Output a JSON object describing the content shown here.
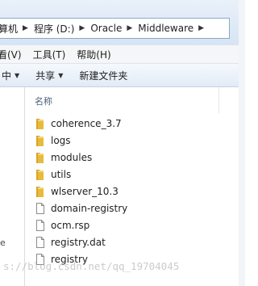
{
  "address": {
    "crumbs": [
      "算机",
      "程序 (D:)",
      "Oracle",
      "Middleware"
    ]
  },
  "menu": [
    "看(V)",
    "工具(T)",
    "帮助(H)"
  ],
  "toolbar": {
    "include_label": "中",
    "share_label": "共享",
    "new_folder_label": "新建文件夹"
  },
  "columns": {
    "name": "名称"
  },
  "files": [
    {
      "name": "coherence_3.7",
      "type": "folder"
    },
    {
      "name": "logs",
      "type": "folder"
    },
    {
      "name": "modules",
      "type": "folder"
    },
    {
      "name": "utils",
      "type": "folder"
    },
    {
      "name": "wlserver_10.3",
      "type": "folder"
    },
    {
      "name": "domain-registry",
      "type": "file"
    },
    {
      "name": "ocm.rsp",
      "type": "file"
    },
    {
      "name": "registry.dat",
      "type": "file"
    },
    {
      "name": "registry",
      "type": "file"
    }
  ],
  "nav_fragment": "e",
  "watermark": "s://blog.csdn.net/qq_19704045",
  "colors": {
    "folder": "#e8bb3c",
    "accent": "#4c607a"
  }
}
